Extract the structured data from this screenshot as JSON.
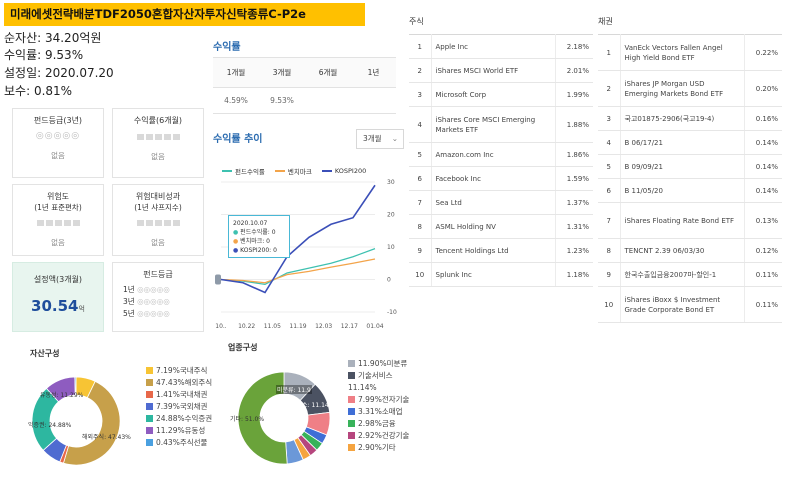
{
  "title": "미래에셋전략배분TDF2050혼합자산자투자신탁종류C-P2e",
  "info": [
    "순자산: 34.20억원",
    "수익률: 9.53%",
    "설정일: 2020.07.20",
    "보수: 0.81%"
  ],
  "cards": {
    "grade3y": {
      "title": "펀드등급(3년)",
      "dots": "◎◎◎◎◎",
      "value": "없음"
    },
    "return6m": {
      "title": "수익률(6개월)",
      "value": "없음"
    },
    "risk": {
      "title": "위험도",
      "sub": "(1년 표준편차)",
      "value": "없음"
    },
    "riskadj": {
      "title": "위험대비성과",
      "sub": "(1년 샤프지수)",
      "value": "없음"
    },
    "aum3m": {
      "title": "설정액(3개월)",
      "value": "30.54",
      "unit": "억"
    },
    "grade": {
      "title": "펀드등급",
      "rows": [
        {
          "label": "1년",
          "dots": "◎◎◎◎◎"
        },
        {
          "label": "3년",
          "dots": "◎◎◎◎◎"
        },
        {
          "label": "5년",
          "dots": "◎◎◎◎◎"
        }
      ]
    }
  },
  "returns": {
    "title": "수익률",
    "headers": [
      "1개월",
      "3개월",
      "6개월",
      "1년"
    ],
    "values": [
      "4.59%",
      "9.53%",
      "",
      ""
    ]
  },
  "trend": {
    "title": "수익률 추이",
    "period": "3개월",
    "legend": [
      "펀드수익률",
      "벤치마크",
      "KOSPI200"
    ],
    "tooltip": {
      "date": "2020.10.07",
      "lines": [
        "펀드수익률: 0",
        "벤치마크: 0",
        "KOSPI200: 0"
      ]
    },
    "colors": {
      "fund": "#3ec1b0",
      "bench": "#f3a44a",
      "kospi": "#3b4fb8"
    }
  },
  "chart_data": {
    "type": "line",
    "x": [
      "10.07",
      "10.12",
      "10.22",
      "11.05",
      "11.19",
      "12.03",
      "12.17",
      "01.04"
    ],
    "xlabels": [
      "10..",
      "10.22",
      "11.05",
      "11.19",
      "12.03",
      "12.17",
      "01.04"
    ],
    "yticks": [
      30,
      20,
      10,
      0,
      -10
    ],
    "ylim": [
      -10,
      30
    ],
    "series": [
      {
        "name": "펀드수익률",
        "values": [
          0,
          -0.5,
          -1.5,
          2,
          3.5,
          5,
          7,
          9.5
        ]
      },
      {
        "name": "벤치마크",
        "values": [
          0,
          -0.3,
          -1,
          1.5,
          2.5,
          3.8,
          5,
          6.3
        ]
      },
      {
        "name": "KOSPI200",
        "values": [
          0,
          -1,
          -4,
          7,
          13,
          17,
          19,
          29
        ]
      }
    ]
  },
  "stocks": {
    "title": "주식",
    "rows": [
      {
        "no": "1",
        "name": "Apple Inc",
        "pct": "2.18%"
      },
      {
        "no": "2",
        "name": "iShares MSCI World ETF",
        "pct": "2.01%"
      },
      {
        "no": "3",
        "name": "Microsoft Corp",
        "pct": "1.99%"
      },
      {
        "no": "4",
        "name": "iShares Core MSCI Emerging Markets ETF",
        "pct": "1.88%"
      },
      {
        "no": "5",
        "name": "Amazon.com Inc",
        "pct": "1.86%"
      },
      {
        "no": "6",
        "name": "Facebook Inc",
        "pct": "1.59%"
      },
      {
        "no": "7",
        "name": "Sea Ltd",
        "pct": "1.37%"
      },
      {
        "no": "8",
        "name": "ASML Holding NV",
        "pct": "1.31%"
      },
      {
        "no": "9",
        "name": "Tencent Holdings Ltd",
        "pct": "1.23%"
      },
      {
        "no": "10",
        "name": "Splunk Inc",
        "pct": "1.18%"
      }
    ]
  },
  "bonds": {
    "title": "채권",
    "rows": [
      {
        "no": "1",
        "name": "VanEck Vectors Fallen Angel High Yield Bond ETF",
        "pct": "0.22%"
      },
      {
        "no": "2",
        "name": "iShares JP Morgan USD Emerging Markets Bond ETF",
        "pct": "0.20%"
      },
      {
        "no": "3",
        "name": "국고01875-2906(국고19-4)",
        "pct": "0.16%"
      },
      {
        "no": "4",
        "name": "B 06/17/21",
        "pct": "0.14%"
      },
      {
        "no": "5",
        "name": "B 09/09/21",
        "pct": "0.14%"
      },
      {
        "no": "6",
        "name": "B 11/05/20",
        "pct": "0.14%"
      },
      {
        "no": "7",
        "name": "iShares Floating Rate Bond ETF",
        "pct": "0.13%"
      },
      {
        "no": "8",
        "name": "TENCNT 2.39 06/03/30",
        "pct": "0.12%"
      },
      {
        "no": "9",
        "name": "한국수출입금융2007마-할인-1",
        "pct": "0.11%"
      },
      {
        "no": "10",
        "name": "iShares iBoxx $ Investment Grade Corporate Bond ET",
        "pct": "0.11%"
      }
    ]
  },
  "assets": {
    "title": "자산구성",
    "items": [
      {
        "label": "7.19%국내주식",
        "value": 7.19,
        "color": "#f7c434"
      },
      {
        "label": "47.43%해외주식",
        "value": 47.43,
        "color": "#c7a04a"
      },
      {
        "label": "1.41%국내채권",
        "value": 1.41,
        "color": "#e8684a"
      },
      {
        "label": "7.39%국외채권",
        "value": 7.39,
        "color": "#4f6bd1"
      },
      {
        "label": "24.88%수익증권",
        "value": 24.88,
        "color": "#2db7a0"
      },
      {
        "label": "11.29%유동성",
        "value": 11.29,
        "color": "#8e5cc0"
      },
      {
        "label": "0.43%주식선물",
        "value": 0.43,
        "color": "#4aa0e0"
      }
    ],
    "slice_labels": [
      "유동성: 11.29%",
      "익증권: 24.88%",
      "해외주식: 47.43%"
    ]
  },
  "sectors": {
    "title": "업종구성",
    "items": [
      {
        "label": "11.90%미분류",
        "value": 11.9,
        "color": "#aab1bc"
      },
      {
        "label": "기술서비스",
        "label2": "11.14%",
        "value": 11.14,
        "color": "#4b5262"
      },
      {
        "label": "7.99%전자기술",
        "value": 7.99,
        "color": "#ef7f86"
      },
      {
        "label": "3.31%소매업",
        "value": 3.31,
        "color": "#3f6ed6"
      },
      {
        "label": "2.98%금융",
        "value": 2.98,
        "color": "#38b25a"
      },
      {
        "label": "2.92%건강기술",
        "value": 2.92,
        "color": "#b6467e"
      },
      {
        "label": "2.90%기타",
        "value": 2.9,
        "color": "#f5a440"
      },
      {
        "label": "",
        "value": 5.76,
        "color": "#6b98d8"
      },
      {
        "label": "",
        "value": 51.1,
        "color": "#6aa33a"
      }
    ],
    "slice_labels": [
      "미분류: 11.9",
      "기술서비스: 11.14",
      "기타: 51.0%"
    ]
  }
}
